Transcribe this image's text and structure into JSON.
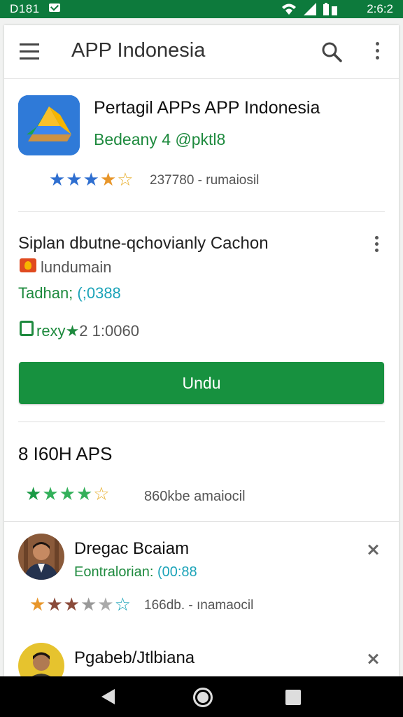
{
  "status_bar": {
    "time_left": "D181",
    "time_right": "2:6:2"
  },
  "toolbar": {
    "title": "APP Indonesia"
  },
  "app": {
    "title": "Pertagil APPs APP Indonesia",
    "developer": "Bedeany 4  @pktl8",
    "rating_text": "237780 - rumaiosil",
    "stars": 3.5
  },
  "section2": {
    "title": "Siplan dbutne-qchovianly Cachon",
    "subtitle": "lundumain",
    "line_label": "Tadhan; ",
    "line_value": "(;0388",
    "meta_label": "rexy",
    "meta_value": "2 1:0060",
    "button_label": "Undu"
  },
  "section3": {
    "title": "8 I60H APS",
    "rating_text": "860kbe   amaiocil",
    "stars": 4
  },
  "reviews": [
    {
      "name": "Dregac Bcaiam",
      "sub_label": "Eontralorian: ",
      "sub_value": "(00:88",
      "rating_text": "166db. - ınamaocil",
      "stars": 3
    },
    {
      "name": "Pgabeb/Jtlbiana"
    }
  ],
  "colors": {
    "status_bar": "#0d7a3c",
    "accent_green": "#17913f",
    "star_green": "#1ea24a",
    "star_blue": "#2f6fd0",
    "star_orange": "#e8962a"
  }
}
